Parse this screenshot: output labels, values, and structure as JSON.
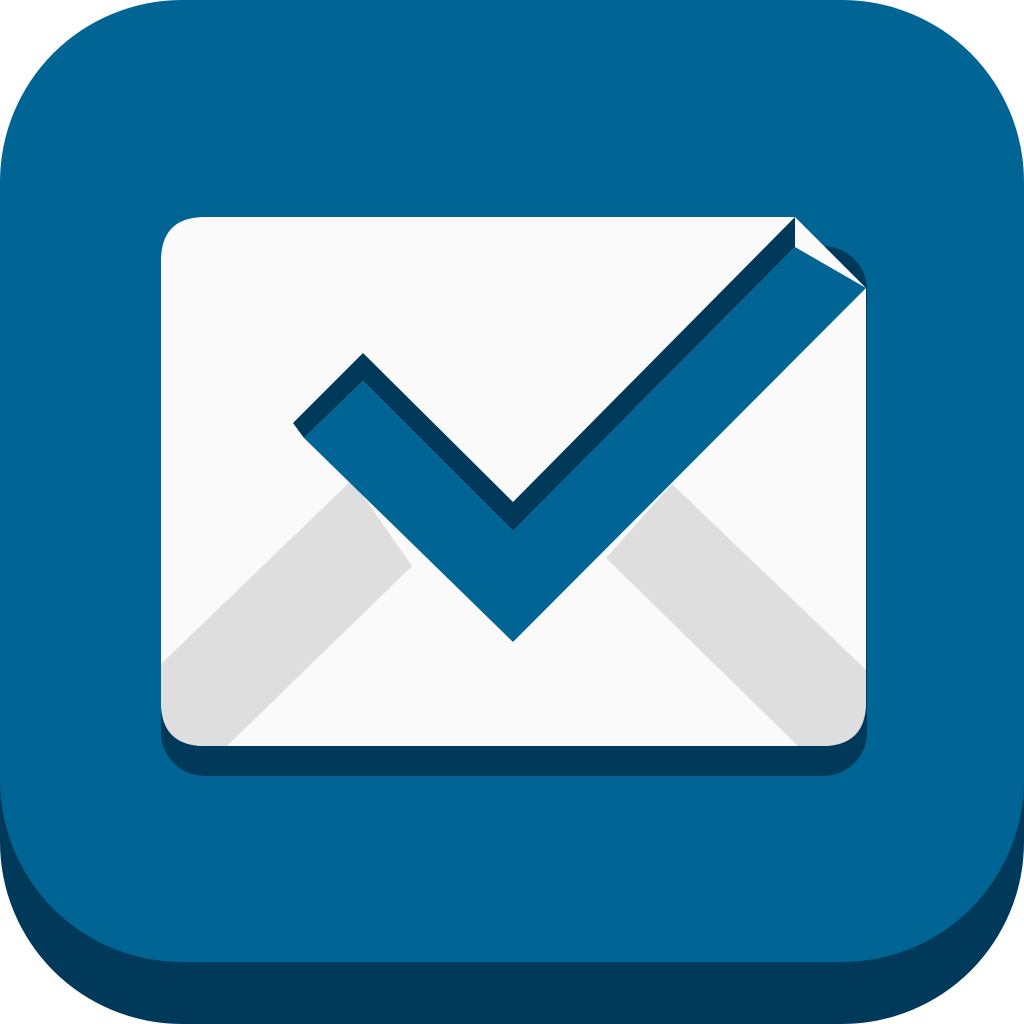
{
  "icon": {
    "name": "mail-checkmark-app-icon",
    "glyphs": [
      "envelope-icon",
      "checkmark-icon"
    ],
    "colors": {
      "tile": "#006495",
      "tile_shadow": "#00395a",
      "envelope": "#fafafa",
      "envelope_fold": "#dedede",
      "envelope_shadow": "#00395a",
      "checkmark": "#006495",
      "checkmark_shadow": "#00395a"
    }
  }
}
